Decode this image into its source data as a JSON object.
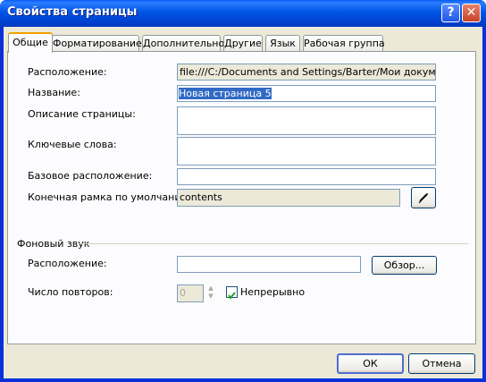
{
  "window": {
    "title": "Свойства страницы"
  },
  "titlebar_buttons": {
    "help": "?",
    "close": "✕"
  },
  "tabs": [
    {
      "label": "Общие",
      "active": true
    },
    {
      "label": "Форматирование",
      "active": false
    },
    {
      "label": "Дополнительно",
      "active": false
    },
    {
      "label": "Другие",
      "active": false
    },
    {
      "label": "Язык",
      "active": false
    },
    {
      "label": "Рабочая группа",
      "active": false
    }
  ],
  "general": {
    "location_label": "Расположение:",
    "location_value": "file:///C:/Documents and Settings/Barter/Мои документы/",
    "title_label": "Название:",
    "title_value": "Новая страница 5",
    "description_label": "Описание страницы:",
    "description_value": "",
    "keywords_label": "Ключевые слова:",
    "keywords_value": "",
    "base_location_label": "Базовое расположение:",
    "base_location_value": "",
    "default_frame_label": "Конечная рамка по умолчанию:",
    "default_frame_value": "contents"
  },
  "background_sound": {
    "group_label": "Фоновый звук",
    "location_label": "Расположение:",
    "location_value": "",
    "browse_label": "Обзор...",
    "loop_label": "Число повторов:",
    "loop_value": "0",
    "forever_label": "Непрерывно",
    "forever_checked": true
  },
  "footer": {
    "ok_label": "ОК",
    "cancel_label": "Отмена"
  },
  "colors": {
    "title_bar": "#0055e5",
    "dialog_face": "#ece9d8",
    "active_tab_accent": "#f0a000"
  }
}
